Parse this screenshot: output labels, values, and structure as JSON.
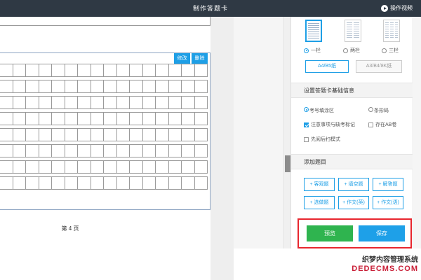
{
  "window": {
    "title": "制作答题卡",
    "help_label": "操作视频"
  },
  "paper": {
    "section_actions": {
      "edit_label": "修改",
      "delete_label": "删除"
    },
    "page_label": "第 4 页"
  },
  "panel": {
    "layout_options": [
      {
        "label": "一栏",
        "selected": true
      },
      {
        "label": "两栏",
        "selected": false
      },
      {
        "label": "三栏",
        "selected": false
      }
    ],
    "paper_sizes": [
      {
        "label": "A4/B5纸",
        "active": true
      },
      {
        "label": "A3/B4/8K纸",
        "active": false
      }
    ],
    "basic_info": {
      "header": "设置答题卡基础信息",
      "exam_no_fill_label": "考号填涂区",
      "barcode_label": "条形码",
      "notes_label": "注意事项与缺考标记",
      "ab_paper_label": "存在AB卷",
      "scan_first_label": "先阅后扫模式"
    },
    "add_questions": {
      "header": "添加题目",
      "buttons": [
        "+ 客观题",
        "+ 填空题",
        "+ 解答题",
        "+ 选做题",
        "+ 作文(英)",
        "+ 作文(语)"
      ]
    },
    "preview_label": "预览",
    "save_label": "保存"
  },
  "watermark": {
    "line1": "织梦内容管理系统",
    "line2": "DEDECMS.COM"
  },
  "colors": {
    "accent": "#1e9fe6",
    "preview_green": "#2fb44f",
    "highlight_red": "#e8262e",
    "titlebar": "#2f3944"
  }
}
